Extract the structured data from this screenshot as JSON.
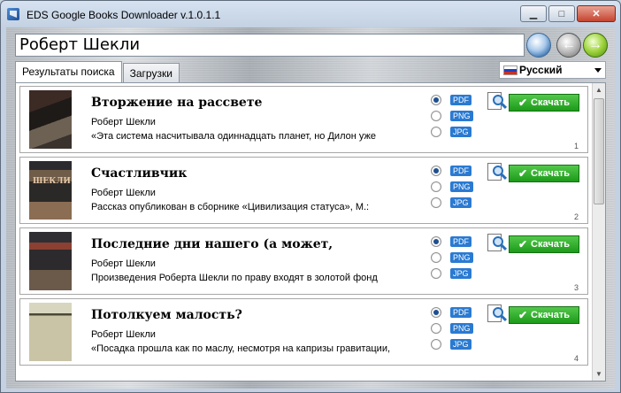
{
  "window": {
    "title": "EDS Google Books Downloader v.1.0.1.1",
    "buttons": {
      "minimize": "▁",
      "maximize": "□",
      "close": "✕"
    }
  },
  "search": {
    "value": "Роберт Шекли"
  },
  "tabs": [
    {
      "label": "Результаты поиска"
    },
    {
      "label": "Загрузки"
    }
  ],
  "language": {
    "selected": "Русский"
  },
  "download_label": "Скачать",
  "formats": [
    "PDF",
    "PNG",
    "JPG"
  ],
  "results": [
    {
      "number": "1",
      "title": "Вторжение на рассвете",
      "author": "Роберт Шекли",
      "snippet": "«Эта система насчитывала одиннадцать планет, но Дилон уже",
      "selected_format": "PDF",
      "cover_text": ""
    },
    {
      "number": "2",
      "title": "Счастливчик",
      "author": "Роберт Шекли",
      "snippet": "Рассказ опубликован в сборнике «Цивилизация статуса», М.:",
      "selected_format": "PDF",
      "cover_text": "ШЕКЛИ"
    },
    {
      "number": "3",
      "title": "Последние дни нашего (а может,",
      "author": "Роберт Шекли",
      "snippet": "Произведения Роберта Шекли по праву входят в золотой фонд",
      "selected_format": "PDF",
      "cover_text": ""
    },
    {
      "number": "4",
      "title": "Потолкуем малость?",
      "author": "Роберт Шекли",
      "snippet": "«Посадка прошла как по маслу, несмотря на капризы гравитации,",
      "selected_format": "PDF",
      "cover_text": ""
    }
  ],
  "colors": {
    "accent_green": "#1d9a1a",
    "badge_blue": "#2a7ad2"
  }
}
